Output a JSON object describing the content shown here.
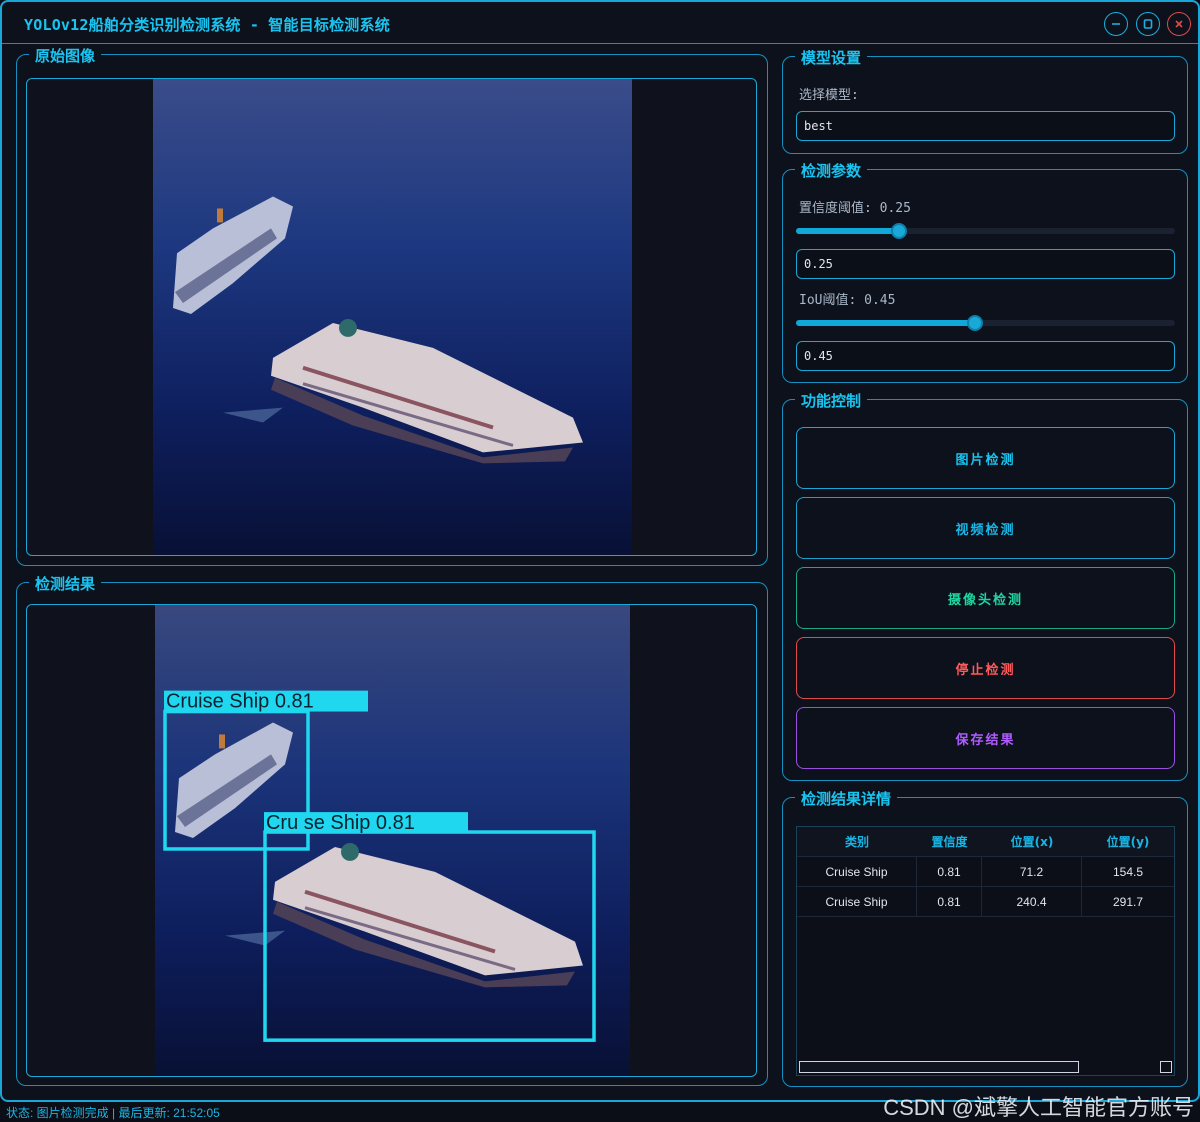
{
  "window": {
    "title": "YOLOv12船舶分类识别检测系统 - 智能目标检测系统"
  },
  "panels": {
    "original": {
      "title": "原始图像"
    },
    "result": {
      "title": "检测结果"
    }
  },
  "model_settings": {
    "title": "模型设置",
    "select_label": "选择模型:",
    "selected_model": "best"
  },
  "detection_params": {
    "title": "检测参数",
    "confidence_label": "置信度阈值: 0.25",
    "confidence_value": "0.25",
    "confidence_level": 0.25,
    "iou_label": "IoU阈值: 0.45",
    "iou_value": "0.45",
    "iou_level": 0.45
  },
  "controls": {
    "title": "功能控制",
    "image_detect": "图片检测",
    "video_detect": "视频检测",
    "camera_detect": "摄像头检测",
    "stop_detect": "停止检测",
    "save_result": "保存结果",
    "colors": {
      "image": "#19c4f0",
      "video": "#19b6e6",
      "camera": "#1fd6a0",
      "stop": "#ff5a5a",
      "save": "#b05cff"
    }
  },
  "detections": {
    "box_labels": [
      "Cruise Ship 0.81",
      "Cru se Ship 0.81"
    ],
    "box_color": "#1fd8f0"
  },
  "result_details": {
    "title": "检测结果详情",
    "columns": [
      "类别",
      "置信度",
      "位置(x)",
      "位置(y)"
    ],
    "rows": [
      [
        "Cruise Ship",
        "0.81",
        "71.2",
        "154.5"
      ],
      [
        "Cruise Ship",
        "0.81",
        "240.4",
        "291.7"
      ]
    ]
  },
  "status": {
    "text": "状态: 图片检测完成 | 最后更新: 21:52:05"
  },
  "watermark": "CSDN @斌擎人工智能官方账号"
}
